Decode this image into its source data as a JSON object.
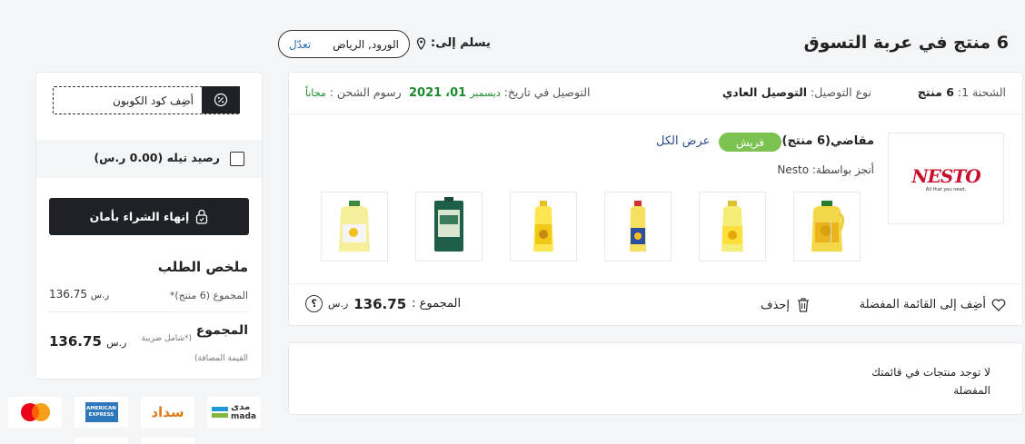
{
  "header": {
    "cart_title": "6 منتج في عربة التسوق",
    "deliver_to_label": "يسلم إلى:",
    "deliver_location": "الورود, الرياض",
    "edit_label": "تعدّل"
  },
  "shipment": {
    "label": "الشحنة 1:",
    "count": "6 منتج",
    "delivery_type_label": "نوع التوصيل:",
    "delivery_type": "التوصيل العادي",
    "delivery_date_label": "التوصيل في تاريخ:",
    "delivery_month": "ديسمبر",
    "delivery_day": "01",
    "delivery_year": "2021",
    "shipping_fee_label": "رسوم الشحن :",
    "shipping_fee": "مجاناً",
    "seller_name": "مقاضي(6 منتج)",
    "fresh_badge": "فريش",
    "view_all": "عرض الكل",
    "fulfilled_by": "أنجز بواسطة: Nesto",
    "logo_text": "NESTO",
    "logo_tagline": "All that you need.",
    "products": [
      {
        "name": "product-oil-1"
      },
      {
        "name": "product-oil-2"
      },
      {
        "name": "product-oil-3"
      },
      {
        "name": "product-oil-4"
      },
      {
        "name": "product-oil-5"
      },
      {
        "name": "product-oil-6"
      }
    ],
    "add_to_wishlist": "أضِف إلى القائمة المفضلة",
    "delete": "إحذف",
    "total_label": "المجموع :",
    "total_value": "136.75",
    "currency": "ر.س",
    "help": "؟"
  },
  "wishlist": {
    "empty_text": "لا توجد منتجات في قائمتك المفضلة"
  },
  "sidebar": {
    "coupon_label": "أضِف كود الكوبون",
    "balance_label": "رصيد تيله (0.00 ر.س)",
    "checkout_label": "إنهاء الشراء بأمان",
    "summary_title": "ملخص الطلب",
    "subtotal_label": "المجموع (6 منتج)*",
    "subtotal_value": "136.75",
    "subtotal_currency": "ر.س",
    "total_label": "المجموع",
    "total_note": "(*شامل ضريبة القيمة المضافة)",
    "total_value": "136.75",
    "total_currency": "ر.س"
  },
  "payments": {
    "mada_ar": "مدى",
    "mada_en": "mada",
    "sadad": "سداد",
    "amex_line1": "AMERICAN",
    "amex_line2": "EXPRESS"
  },
  "colors": {
    "primary_dark": "#1e2126",
    "fresh_green": "#7cc251",
    "date_green": "#1e8a2e",
    "link_blue": "#2b4d8c",
    "nesto_red": "#c8102e"
  }
}
